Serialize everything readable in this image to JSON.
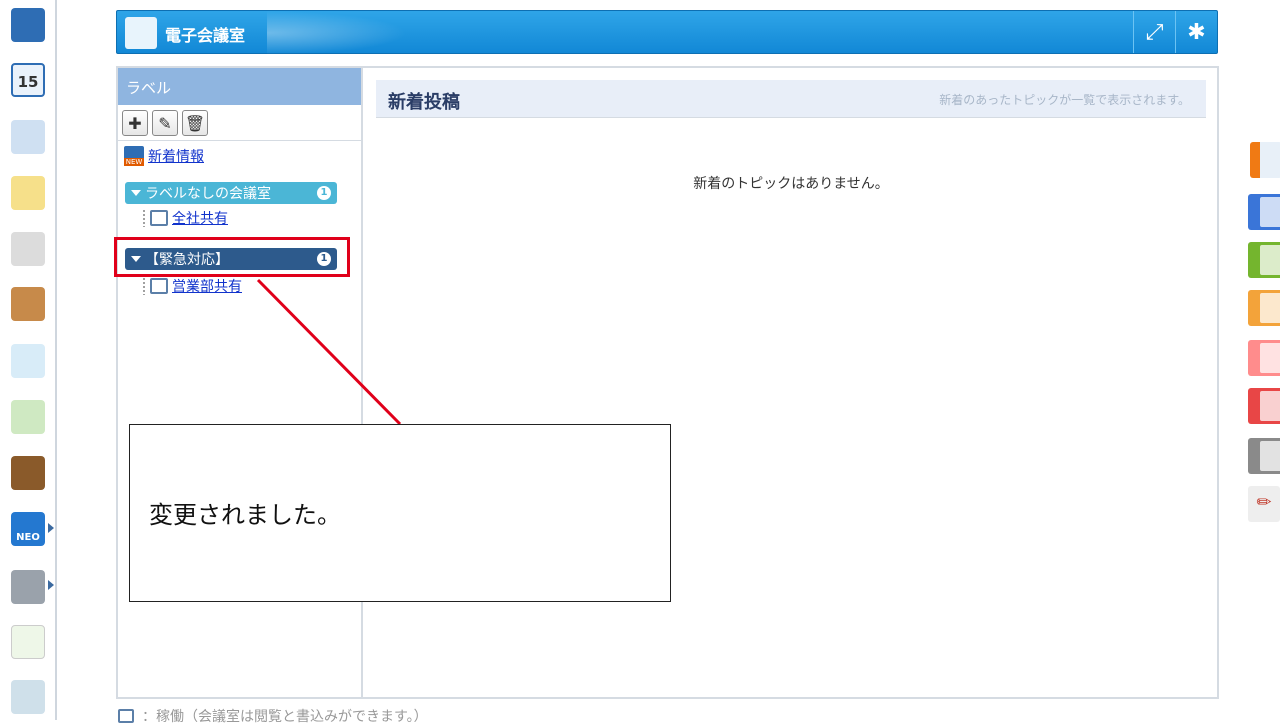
{
  "header": {
    "title": "電子会議室"
  },
  "sidebar": {
    "heading": "ラベル",
    "news_link": "新着情報",
    "labels": [
      {
        "name": "ラベルなしの会議室",
        "count": "1",
        "color": "#4bb6d6",
        "room": "全社共有"
      },
      {
        "name": "【緊急対応】",
        "count": "1",
        "color": "#2d5a8c",
        "room": "営業部共有"
      }
    ]
  },
  "content": {
    "title": "新着投稿",
    "description": "新着のあったトピックが一覧で表示されます。",
    "empty_message": "新着のトピックはありません。"
  },
  "callout": {
    "message": "変更されました。"
  },
  "footer": {
    "note": "：稼働（会議室は閲覧と書込みができます。）"
  },
  "dock": {
    "calendar_day": "15",
    "logo_text": "NEO"
  },
  "palette": {
    "colors": [
      "#3a75d8",
      "#74b52e",
      "#f3a33a",
      "#ff8c8c",
      "#e84646",
      "#8a8a8a"
    ]
  }
}
